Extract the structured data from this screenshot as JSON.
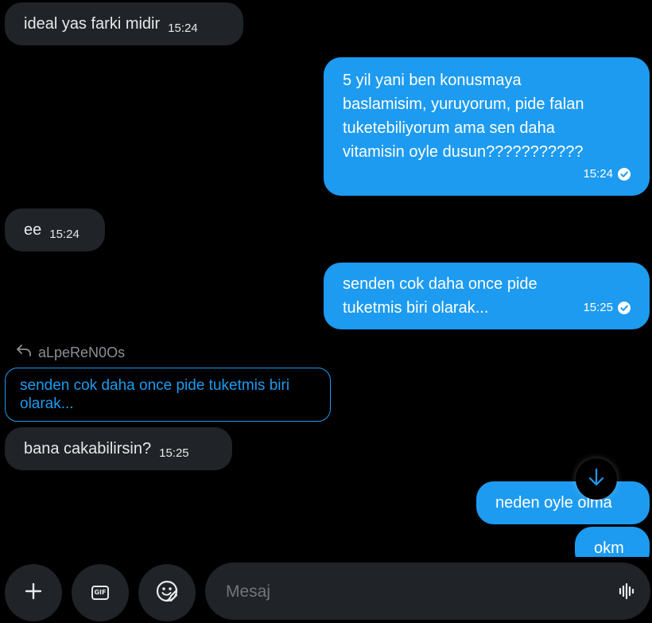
{
  "colors": {
    "background": "#000000",
    "incoming_bubble": "#202327",
    "outgoing_bubble": "#1d9bf0",
    "quote_accent": "#1d9bf0"
  },
  "messages": [
    {
      "direction": "incoming",
      "text": "ideal yas farki midir",
      "time": "15:24"
    },
    {
      "direction": "outgoing",
      "lines": [
        "5 yil yani ben konusmaya",
        "baslamisim, yuruyorum, pide falan",
        "tuketebiliyorum ama sen daha",
        "vitamisin oyle dusun???????????"
      ],
      "time": "15:24",
      "status_icon": "check-circle-icon"
    },
    {
      "direction": "incoming",
      "text": "ee",
      "time": "15:24"
    },
    {
      "direction": "outgoing",
      "lines": [
        "senden cok daha once pide",
        "tuketmis biri olarak..."
      ],
      "time": "15:25",
      "status_icon": "check-circle-icon"
    },
    {
      "direction": "incoming",
      "reply_to": {
        "author": "aLpeReN0Os",
        "text": "senden cok daha once pide tuketmis biri olarak..."
      },
      "text": "bana cakabilirsin?",
      "time": "15:25"
    },
    {
      "direction": "outgoing",
      "text": "neden oyle olma"
    },
    {
      "direction": "outgoing",
      "text": "okm"
    }
  ],
  "composer": {
    "placeholder": "Mesaj",
    "add_icon": "plus-icon",
    "gif_label": "GIF",
    "emoji_icon": "emoji-icon",
    "voice_icon": "voice-waveform-icon"
  },
  "scroll_button_icon": "arrow-down-icon"
}
